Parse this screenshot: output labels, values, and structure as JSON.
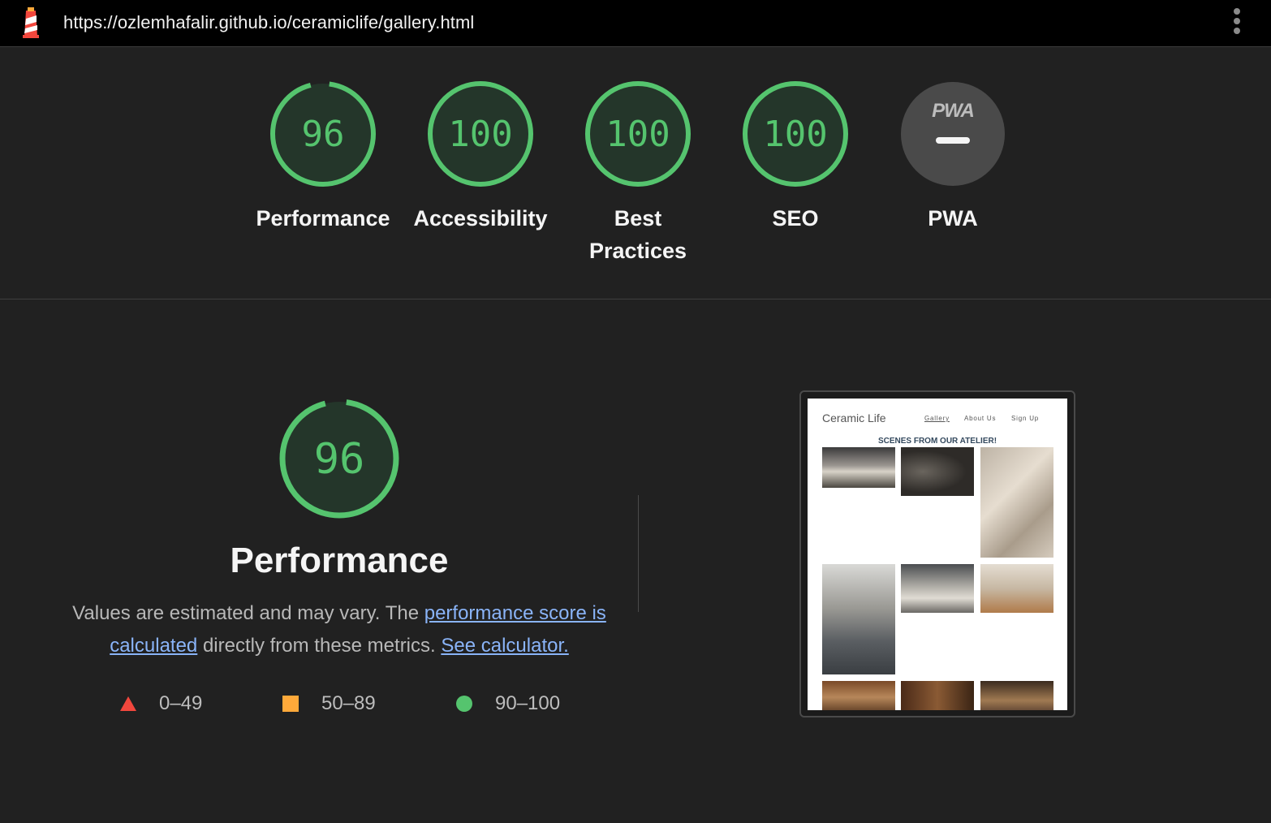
{
  "browser": {
    "url": "https://ozlemhafalir.github.io/ceramiclife/gallery.html",
    "logo_icon": "lighthouse-icon",
    "menu_icon": "kebab-menu-icon"
  },
  "colors": {
    "pass": "#55c46e",
    "average": "#ffa93a",
    "fail": "#f2473d",
    "link": "#8ab4f8"
  },
  "categories": [
    {
      "label": "Performance",
      "score": "96",
      "value": 96
    },
    {
      "label": "Accessibility",
      "score": "100",
      "value": 100
    },
    {
      "label_line1": "Best",
      "label_line2": "Practices",
      "score": "100",
      "value": 100
    },
    {
      "label": "SEO",
      "score": "100",
      "value": 100
    },
    {
      "label": "PWA",
      "badge_text": "PWA"
    }
  ],
  "performance": {
    "score": "96",
    "value": 96,
    "title": "Performance",
    "desc_prefix": "Values are estimated and may vary. The ",
    "link_score": "performance score is calculated",
    "desc_middle": " directly from these metrics. ",
    "link_calculator": "See calculator."
  },
  "legend": {
    "fail": "0–49",
    "average": "50–89",
    "pass": "90–100"
  },
  "screenshot": {
    "site_title": "Ceramic Life",
    "nav": [
      "Gallery",
      "About Us",
      "Sign Up"
    ],
    "heading": "SCENES FROM OUR ATELIER!"
  }
}
